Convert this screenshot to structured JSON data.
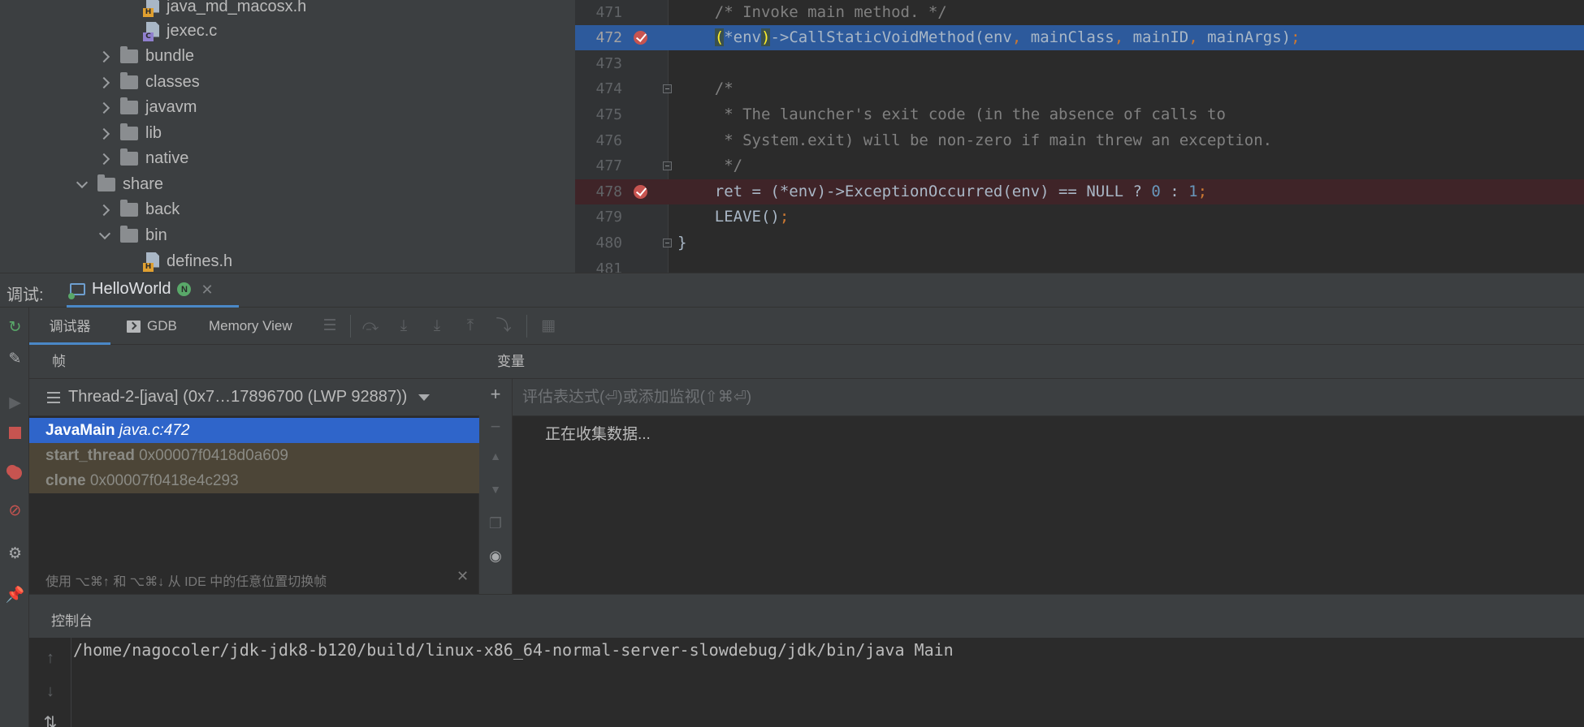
{
  "project_tree": {
    "items": [
      {
        "label": "java_md_macosx.h",
        "kind": "h"
      },
      {
        "label": "jexec.c",
        "kind": "c"
      },
      {
        "label": "bundle",
        "kind": "folder"
      },
      {
        "label": "classes",
        "kind": "folder"
      },
      {
        "label": "javavm",
        "kind": "folder"
      },
      {
        "label": "lib",
        "kind": "folder"
      },
      {
        "label": "native",
        "kind": "folder"
      },
      {
        "label": "share",
        "kind": "folder"
      },
      {
        "label": "back",
        "kind": "folder"
      },
      {
        "label": "bin",
        "kind": "folder"
      },
      {
        "label": "defines.h",
        "kind": "h"
      }
    ]
  },
  "editor": {
    "lines": [
      {
        "num": "471",
        "segments": [
          {
            "t": "    ",
            "c": ""
          },
          {
            "t": "/* Invoke main method. */",
            "c": "c-comment"
          }
        ]
      },
      {
        "num": "472",
        "segments": [
          {
            "t": "    ",
            "c": ""
          },
          {
            "t": "(",
            "c": "c-paren"
          },
          {
            "t": "*env",
            "c": ""
          },
          {
            "t": ")",
            "c": "c-paren"
          },
          {
            "t": "->CallStaticVoidMethod(env",
            "c": ""
          },
          {
            "t": ", ",
            "c": "c-punct"
          },
          {
            "t": "mainClass",
            "c": ""
          },
          {
            "t": ", ",
            "c": "c-punct"
          },
          {
            "t": "mainID",
            "c": ""
          },
          {
            "t": ", ",
            "c": "c-punct"
          },
          {
            "t": "mainArgs)",
            "c": ""
          },
          {
            "t": ";",
            "c": "c-punct"
          }
        ]
      },
      {
        "num": "473",
        "segments": []
      },
      {
        "num": "474",
        "segments": [
          {
            "t": "    ",
            "c": ""
          },
          {
            "t": "/*",
            "c": "c-comment"
          }
        ]
      },
      {
        "num": "475",
        "segments": [
          {
            "t": "     ",
            "c": ""
          },
          {
            "t": "* The launcher's exit code (in the absence of calls to",
            "c": "c-comment"
          }
        ]
      },
      {
        "num": "476",
        "segments": [
          {
            "t": "     ",
            "c": ""
          },
          {
            "t": "* System.exit) will be non-zero if main threw an exception.",
            "c": "c-comment"
          }
        ]
      },
      {
        "num": "477",
        "segments": [
          {
            "t": "     ",
            "c": ""
          },
          {
            "t": "*/",
            "c": "c-comment"
          }
        ]
      },
      {
        "num": "478",
        "segments": [
          {
            "t": "    ret = (*env)->ExceptionOccurred(env) == NULL ? ",
            "c": ""
          },
          {
            "t": "0",
            "c": "c-num"
          },
          {
            "t": " : ",
            "c": ""
          },
          {
            "t": "1",
            "c": "c-num"
          },
          {
            "t": ";",
            "c": "c-punct"
          }
        ]
      },
      {
        "num": "479",
        "segments": [
          {
            "t": "    LEAVE()",
            "c": ""
          },
          {
            "t": ";",
            "c": "c-punct"
          }
        ]
      },
      {
        "num": "480",
        "segments": [
          {
            "t": "}",
            "c": ""
          }
        ]
      },
      {
        "num": "481",
        "segments": []
      }
    ]
  },
  "debug": {
    "label": "调试:",
    "session_tab": "HelloWorld",
    "session_badge": "N",
    "close_glyph": "✕",
    "tabs": {
      "debugger": "调试器",
      "gdb": "GDB",
      "memory": "Memory View"
    }
  },
  "frames": {
    "title": "帧",
    "thread": "Thread-2-[java] (0x7…17896700 (LWP 92887))",
    "rows": [
      {
        "name": "JavaMain",
        "detail": "java.c:472"
      },
      {
        "name": "start_thread",
        "detail": "0x00007f0418d0a609"
      },
      {
        "name": "clone",
        "detail": "0x00007f0418e4c293"
      }
    ],
    "hint": "使用 ⌥⌘↑ 和 ⌥⌘↓ 从 IDE 中的任意位置切换帧",
    "hint_close": "✕"
  },
  "variables": {
    "title": "变量",
    "eval_placeholder": "评估表达式(⏎)或添加监视(⇧⌘⏎)",
    "status": "正在收集数据..."
  },
  "console": {
    "title": "控制台",
    "command": "/home/nagocoler/jdk-jdk8-b120/build/linux-x86_64-normal-server-slowdebug/jdk/bin/java Main"
  },
  "colors": {
    "selection": "#2f65ca",
    "exec_line": "#2d5a9c",
    "breakpoint": "#c75450",
    "accent": "#4a88c7"
  }
}
